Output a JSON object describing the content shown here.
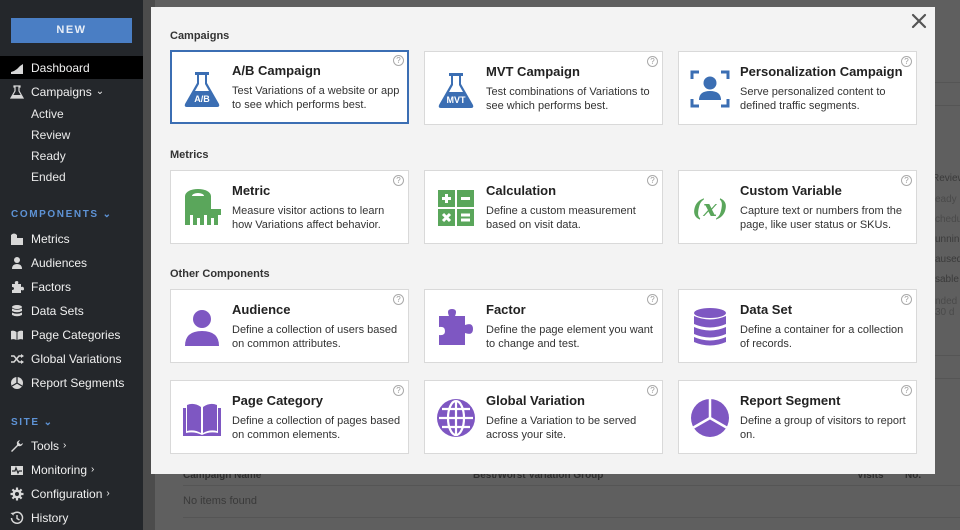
{
  "sidebar": {
    "new_label": "NEW",
    "dashboard": "Dashboard",
    "campaigns": "Campaigns",
    "campaign_subitems": [
      "Active",
      "Review",
      "Ready",
      "Ended"
    ],
    "components_header": "COMPONENTS",
    "components": [
      "Metrics",
      "Audiences",
      "Factors",
      "Data Sets",
      "Page Categories",
      "Global Variations",
      "Report Segments"
    ],
    "site_header": "SITE",
    "site_items": [
      "Tools",
      "Monitoring",
      "Configuration",
      "History"
    ]
  },
  "background": {
    "status_fragments": [
      "Review",
      "eady",
      "chedu",
      "unning",
      "aused",
      "sable",
      "nded",
      "30 d"
    ],
    "table_headers": [
      "Campaign Name",
      "Best/Worst Variation Group",
      "Visits",
      "No."
    ],
    "empty_message": "No items found"
  },
  "modal": {
    "close_label": "×",
    "groups": [
      {
        "title": "Campaigns",
        "cards": [
          {
            "title": "A/B Campaign",
            "desc": "Test Variations of a website or app to see which performs best.",
            "icon": "flask-ab-icon",
            "badge": "A/B",
            "selected": true
          },
          {
            "title": "MVT Campaign",
            "desc": "Test combinations of Variations to see which performs best.",
            "icon": "flask-mvt-icon",
            "badge": "MVT"
          },
          {
            "title": "Personalization Campaign",
            "desc": "Serve personalized content to defined traffic segments.",
            "icon": "person-target-icon"
          }
        ]
      },
      {
        "title": "Metrics",
        "cards": [
          {
            "title": "Metric",
            "desc": "Measure visitor actions to learn how Variations affect behavior.",
            "icon": "tape-measure-icon"
          },
          {
            "title": "Calculation",
            "desc": "Define a custom measurement based on visit data.",
            "icon": "calculator-icon"
          },
          {
            "title": "Custom Variable",
            "desc": "Capture text or numbers from the page, like user status or SKUs.",
            "icon": "variable-x-icon",
            "glyph": "(x)"
          }
        ]
      },
      {
        "title": "Other Components",
        "cards": [
          {
            "title": "Audience",
            "desc": "Define a collection of users based on common attributes.",
            "icon": "person-icon"
          },
          {
            "title": "Factor",
            "desc": "Define the page element you want to change and test.",
            "icon": "puzzle-icon"
          },
          {
            "title": "Data Set",
            "desc": "Define a container for a collection of records.",
            "icon": "database-icon"
          },
          {
            "title": "Page Category",
            "desc": "Define a collection of pages based on common elements.",
            "icon": "book-icon"
          },
          {
            "title": "Global Variation",
            "desc": "Define a Variation to be served across your site.",
            "icon": "globe-icon"
          },
          {
            "title": "Report Segment",
            "desc": "Define a group of visitors to report on.",
            "icon": "pie-segment-icon"
          }
        ]
      }
    ]
  },
  "colors": {
    "campaign_blue": "#3b6eb3",
    "metric_green": "#5aa65b",
    "component_purple": "#7e57c2",
    "sidebar_bg": "#24272b",
    "new_button": "#4a7ec4",
    "section_header": "#5e93d6"
  }
}
